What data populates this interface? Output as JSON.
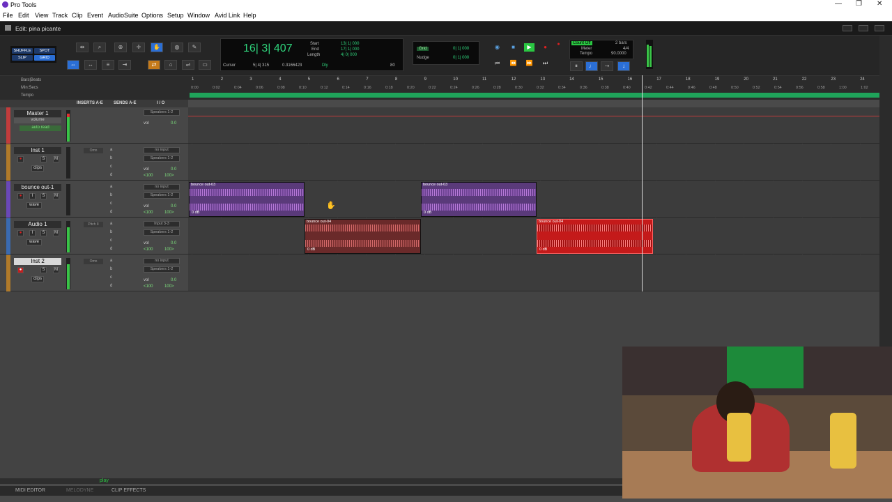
{
  "window": {
    "title": "Pro Tools"
  },
  "menu": [
    "File",
    "Edit",
    "View",
    "Track",
    "Clip",
    "Event",
    "AudioSuite",
    "Options",
    "Setup",
    "Window",
    "Avid Link",
    "Help"
  ],
  "edit_window": {
    "title": "Edit: pina picante"
  },
  "modes": {
    "shuffle": "SHUFFLE",
    "spot": "SPOT",
    "slip": "SLIP",
    "grid": "GRID"
  },
  "counter": {
    "main": "16| 3| 407",
    "start_label": "Start",
    "end_label": "End",
    "length_label": "Length",
    "start": "13| 1| 000",
    "end": "17| 1| 000",
    "length": "4| 0| 000",
    "cursor_label": "Cursor",
    "cursor": "5| 4| 315",
    "sub": "0.3166423",
    "dly": "Dly",
    "value": "80"
  },
  "grid": {
    "grid_label": "Grid",
    "grid_value": "0| 1| 000",
    "nudge_label": "Nudge",
    "nudge_value": "0| 1| 000"
  },
  "counters2": {
    "count_off": "Count Off",
    "meter_label": "Meter",
    "tempo_label": "Tempo",
    "bars": "2 bars",
    "meter": "4/4",
    "tempo": "90.0000"
  },
  "rulers": {
    "bars": "Bars|Beats",
    "min": "Min:Secs",
    "tempo": "Tempo"
  },
  "bar_ticks": [
    "1",
    "2",
    "3",
    "4",
    "5",
    "6",
    "7",
    "8",
    "9",
    "10",
    "11",
    "12",
    "13",
    "14",
    "15",
    "16",
    "17",
    "18",
    "19",
    "20",
    "21",
    "22",
    "23",
    "24"
  ],
  "time_ticks": [
    "0:00",
    "0:02",
    "0:04",
    "0:06",
    "0:08",
    "0:10",
    "0:12",
    "0:14",
    "0:16",
    "0:18",
    "0:20",
    "0:22",
    "0:24",
    "0:26",
    "0:28",
    "0:30",
    "0:32",
    "0:34",
    "0:36",
    "0:38",
    "0:40",
    "0:42",
    "0:44",
    "0:46",
    "0:48",
    "0:50",
    "0:52",
    "0:54",
    "0:56",
    "0:58",
    "1:00",
    "1:02"
  ],
  "columns": {
    "inserts": "INSERTS A-E",
    "sends": "SENDS A-E",
    "io": "I / O"
  },
  "tracks": [
    {
      "name": "Master 1",
      "io_out": "Speakers 1-2",
      "vol_label": "vol",
      "vol": "0.0",
      "mode": "volume",
      "auto": "auto read",
      "color": "#c23c3c",
      "meter": 90
    },
    {
      "name": "Inst 1",
      "input": "no input",
      "io_out": "Speakers 1-2",
      "vol_label": "vol",
      "vol": "0.0",
      "pan_l": "<100",
      "pan_r": "100>",
      "view": "clips",
      "ins": "Omn",
      "color": "#b07a2a",
      "meter": 0
    },
    {
      "name": "bounce out-1",
      "input": "no input",
      "io_out": "Speakers 1-2",
      "vol_label": "vol",
      "vol": "0.0",
      "pan_l": "<100",
      "pan_r": "100>",
      "view": "wave",
      "color": "#6a48b8",
      "meter": 0
    },
    {
      "name": "Audio 1",
      "input": "Input 3-3",
      "io_out": "Speakers 1-2",
      "vol_label": "vol",
      "vol": "0.0",
      "pan_l": "<100",
      "pan_r": "100>",
      "view": "wave",
      "ins": "Pitch II",
      "color": "#3a6ab0",
      "meter": 80
    },
    {
      "name": "Inst 2",
      "input": "no input",
      "io_out": "Speakers 1-2",
      "vol_label": "vol",
      "vol": "0.0",
      "pan_l": "<100",
      "pan_r": "100>",
      "view": "clips",
      "ins": "Omn",
      "color": "#b07a2a",
      "meter": 80
    }
  ],
  "sends_letters": [
    "a",
    "b",
    "c",
    "d"
  ],
  "buttons": {
    "solo": "S",
    "mute": "M",
    "input": "I",
    "pan_label": "p"
  },
  "clips": [
    {
      "name": "bounce out-03",
      "db": "0 dB",
      "color": "#5a3a7a",
      "wave": "#b77ad8"
    },
    {
      "name": "bounce out-03",
      "db": "0 dB",
      "color": "#5a3a7a",
      "wave": "#b77ad8"
    },
    {
      "name": "bounce out-04",
      "db": "0 dB",
      "color": "#6a2a2a",
      "wave": "#d46a6a"
    },
    {
      "name": "bounce out-04",
      "db": "0 dB",
      "color": "#c41a1a",
      "wave": "#ff5050"
    }
  ],
  "transport": {
    "play_label": "play"
  },
  "dock": {
    "midi": "MIDI EDITOR",
    "melodyne": "MELODYNE",
    "clip_fx": "CLIP EFFECTS"
  }
}
